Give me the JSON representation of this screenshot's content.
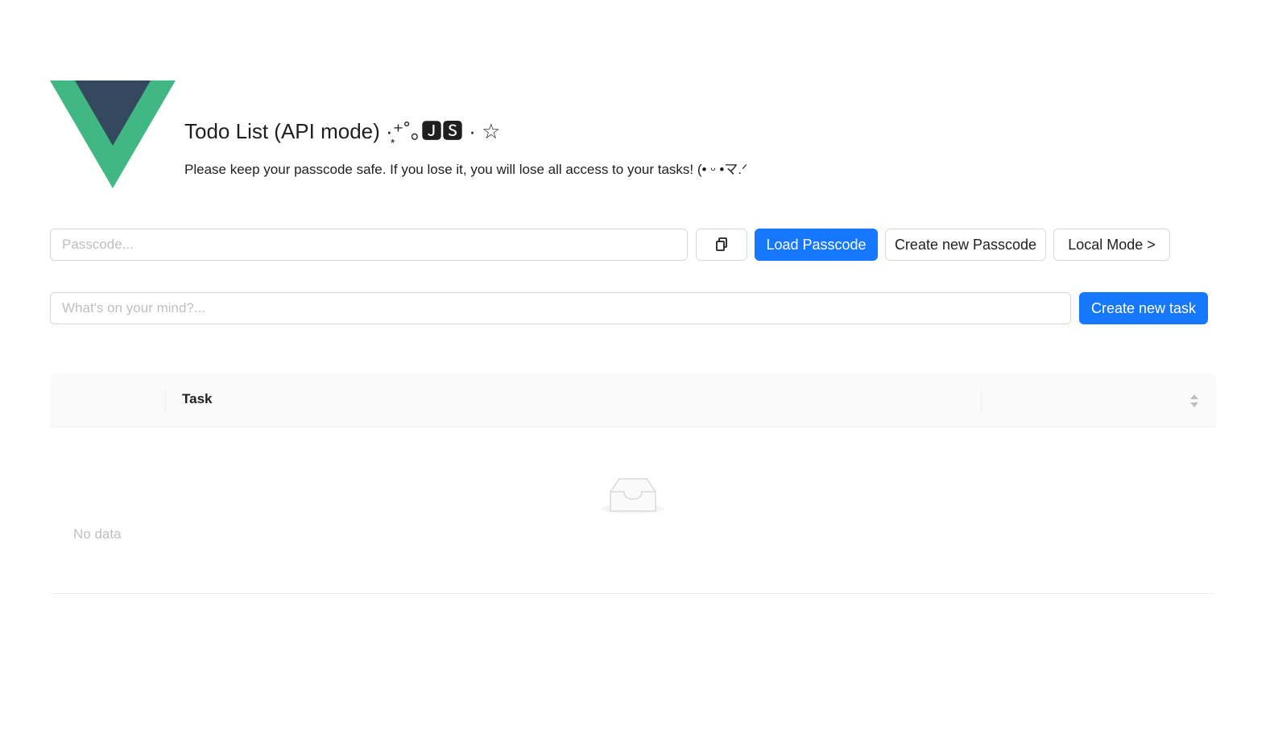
{
  "header": {
    "title": "Todo List (API mode) ·͙⁺˚｡🅹🆂 · ☆",
    "subtitle": "Please keep your passcode safe. If you lose it, you will lose all access to your tasks!  (• ᵕ •マ.ᐟ",
    "logo_colors": {
      "outer": "#41b883",
      "inner": "#34495e"
    }
  },
  "passcode_row": {
    "passcode_placeholder": "Passcode...",
    "passcode_value": "",
    "copy_icon": "copy-icon",
    "load_label": "Load Passcode",
    "create_label": "Create new Passcode",
    "local_mode_label": "Local Mode >"
  },
  "task_row": {
    "task_placeholder": "What's on your mind?...",
    "task_value": "",
    "create_task_label": "Create new task"
  },
  "table": {
    "columns": [
      "",
      "Task",
      ""
    ],
    "rows": [],
    "empty_text": "No data",
    "sort_icon": "sort-icon",
    "empty_icon": "inbox-icon"
  },
  "colors": {
    "primary": "#1677ff",
    "border": "#d9d9d9",
    "placeholder": "#bfbfbf",
    "header_bg": "#fafafa"
  }
}
